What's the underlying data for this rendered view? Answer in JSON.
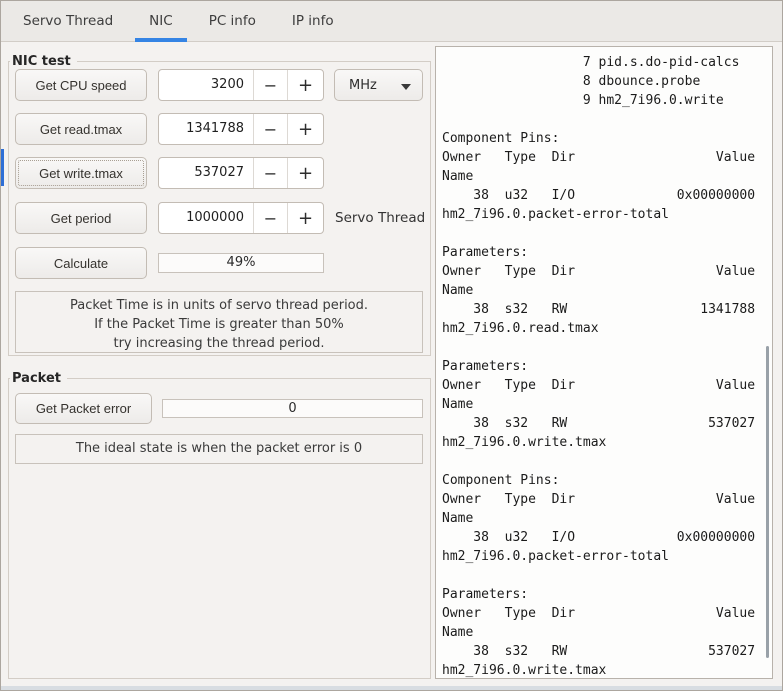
{
  "tabs": {
    "items": [
      {
        "label": "Servo Thread",
        "active": false
      },
      {
        "label": "NIC",
        "active": true
      },
      {
        "label": "PC info",
        "active": false
      },
      {
        "label": "IP info",
        "active": false
      }
    ]
  },
  "nic_test": {
    "title": "NIC test",
    "cpu": {
      "button": "Get CPU speed",
      "value": "3200",
      "unit": "MHz"
    },
    "read": {
      "button": "Get read.tmax",
      "value": "1341788"
    },
    "write": {
      "button": "Get write.tmax",
      "value": "537027"
    },
    "period": {
      "button": "Get period",
      "value": "1000000",
      "label": "Servo Thread"
    },
    "calculate": {
      "button": "Calculate",
      "result": "49%"
    },
    "spin": {
      "minus": "−",
      "plus": "+"
    },
    "note_lines": [
      "Packet Time is in units of servo thread period.",
      "If the Packet Time is greater than 50%",
      "try increasing the thread period."
    ]
  },
  "packet": {
    "title": "Packet",
    "button": "Get Packet error",
    "value": "0",
    "note": "The ideal state is when the packet error is 0"
  },
  "terminal": {
    "lines": [
      "                  7 pid.s.do-pid-calcs",
      "                  8 dbounce.probe",
      "                  9 hm2_7i96.0.write",
      "",
      "Component Pins:",
      "Owner   Type  Dir                  Value",
      "Name",
      "    38  u32   I/O             0x00000000",
      "hm2_7i96.0.packet-error-total",
      "",
      "Parameters:",
      "Owner   Type  Dir                  Value",
      "Name",
      "    38  s32   RW                 1341788",
      "hm2_7i96.0.read.tmax",
      "",
      "Parameters:",
      "Owner   Type  Dir                  Value",
      "Name",
      "    38  s32   RW                  537027",
      "hm2_7i96.0.write.tmax",
      "",
      "Component Pins:",
      "Owner   Type  Dir                  Value",
      "Name",
      "    38  u32   I/O             0x00000000",
      "hm2_7i96.0.packet-error-total",
      "",
      "Parameters:",
      "Owner   Type  Dir                  Value",
      "Name",
      "    38  s32   RW                  537027",
      "hm2_7i96.0.write.tmax"
    ]
  },
  "colors": {
    "accent": "#3584e4",
    "focus_strip": "#2e6fd6",
    "tabbar_bg": "#ebe9e6",
    "window_bg": "#f4f2f0",
    "terminal_bg": "#fdfdfc"
  }
}
